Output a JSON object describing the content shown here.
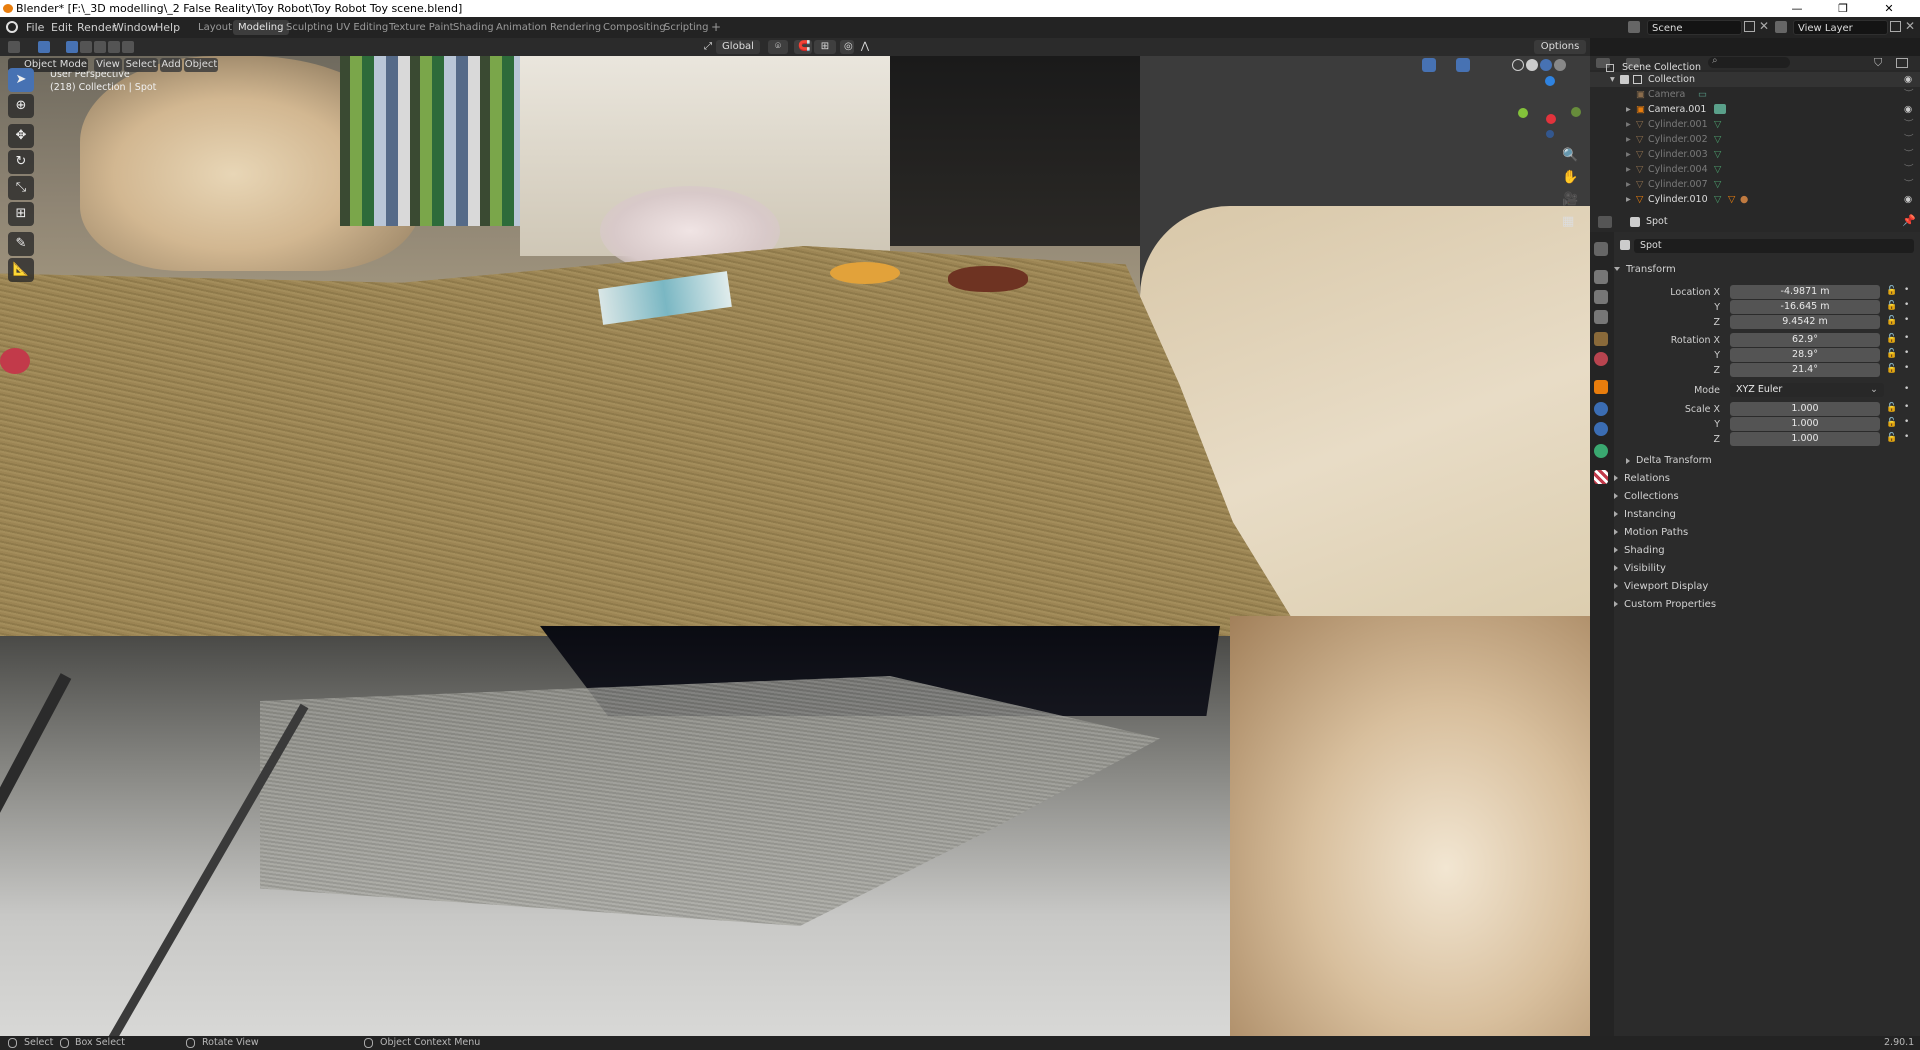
{
  "window": {
    "title": "Blender* [F:\\_3D modelling\\_2 False Reality\\Toy Robot\\Toy Robot Toy scene.blend]",
    "minimize": "—",
    "maximize": "❐",
    "close": "✕"
  },
  "menus": [
    "File",
    "Edit",
    "Render",
    "Window",
    "Help"
  ],
  "workspaces": [
    "Layout",
    "Modeling",
    "Sculpting",
    "UV Editing",
    "Texture Paint",
    "Shading",
    "Animation",
    "Rendering",
    "Compositing",
    "Scripting"
  ],
  "active_workspace": "Modeling",
  "add_workspace": "+",
  "scene": {
    "label": "Scene",
    "view_layer": "View Layer"
  },
  "header": {
    "mode": "Object Mode",
    "view": "View",
    "select": "Select",
    "add": "Add",
    "object": "Object",
    "transform_orientation": "Global",
    "options": "Options"
  },
  "viewport": {
    "perspective": "User Perspective",
    "collection_info": "(218) Collection | Spot"
  },
  "outliner": {
    "search_placeholder": "",
    "rows": [
      {
        "name": "Scene Collection",
        "dim": false
      },
      {
        "name": "Collection",
        "dim": false
      },
      {
        "name": "Camera",
        "dim": true
      },
      {
        "name": "Camera.001",
        "dim": false
      },
      {
        "name": "Cylinder.001",
        "dim": true
      },
      {
        "name": "Cylinder.002",
        "dim": true
      },
      {
        "name": "Cylinder.003",
        "dim": true
      },
      {
        "name": "Cylinder.004",
        "dim": true
      },
      {
        "name": "Cylinder.007",
        "dim": true
      },
      {
        "name": "Cylinder.010",
        "dim": false
      }
    ]
  },
  "properties": {
    "object_name": "Spot",
    "datablock_name": "Spot",
    "transform_title": "Transform",
    "location_label": "Location X",
    "location": {
      "x": "-4.9871 m",
      "y": "-16.645 m",
      "z": "9.4542 m"
    },
    "rotation_label": "Rotation X",
    "rotation": {
      "x": "62.9°",
      "y": "28.9°",
      "z": "21.4°"
    },
    "mode_label": "Mode",
    "mode_value": "XYZ Euler",
    "scale_label": "Scale X",
    "scale": {
      "x": "1.000",
      "y": "1.000",
      "z": "1.000"
    },
    "y_label": "Y",
    "z_label": "Z",
    "delta_transform": "Delta Transform",
    "panels": [
      "Relations",
      "Collections",
      "Instancing",
      "Motion Paths",
      "Shading",
      "Visibility",
      "Viewport Display",
      "Custom Properties"
    ]
  },
  "status": {
    "select": "Select",
    "box_select": "Box Select",
    "rotate_view": "Rotate View",
    "context_menu": "Object Context Menu",
    "version": "2.90.1"
  },
  "colors": {
    "accent": "#4772b3",
    "active_object": "#e87d0d",
    "camera": "#5aa08a"
  }
}
